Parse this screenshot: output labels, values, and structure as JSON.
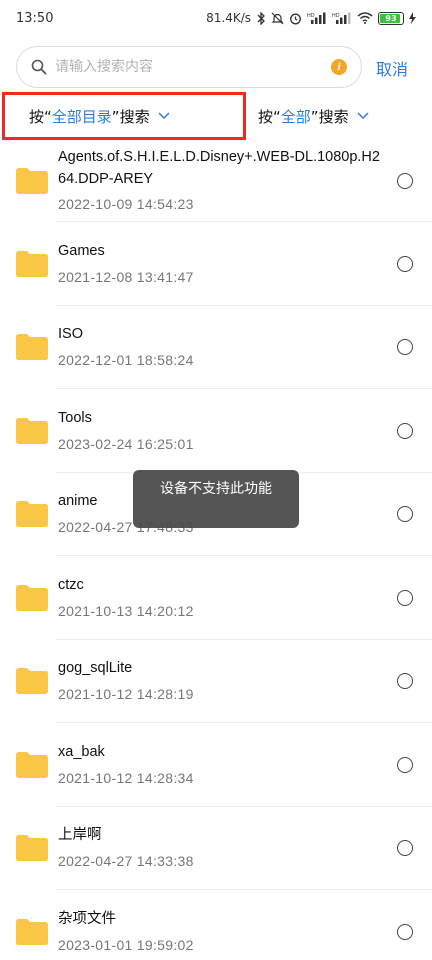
{
  "status_bar": {
    "time": "13:50",
    "network_speed": "81.4K/s",
    "battery_level": "93",
    "accent_battery": "#3cc13c"
  },
  "search": {
    "placeholder": "请输入搜索内容",
    "value": "",
    "cancel_label": "取消"
  },
  "filters": {
    "scope": {
      "prefix": "按“",
      "value": "全部目录",
      "suffix": "”搜索"
    },
    "type": {
      "prefix": "按“",
      "value": "全部",
      "suffix": "”搜索"
    }
  },
  "files": [
    {
      "name": "Agents.of.S.H.I.E.L.D.Disney+.WEB-DL.1080p.H264.DDP-AREY",
      "date": "2022-10-09 14:54:23"
    },
    {
      "name": "Games",
      "date": "2021-12-08 13:41:47"
    },
    {
      "name": "ISO",
      "date": "2022-12-01 18:58:24"
    },
    {
      "name": "Tools",
      "date": "2023-02-24 16:25:01"
    },
    {
      "name": "anime",
      "date": "2022-04-27 17:48:33"
    },
    {
      "name": "ctzc",
      "date": "2021-10-13 14:20:12"
    },
    {
      "name": "gog_sqlLite",
      "date": "2021-10-12 14:28:19"
    },
    {
      "name": "xa_bak",
      "date": "2021-10-12 14:28:34"
    },
    {
      "name": "上岸啊",
      "date": "2022-04-27 14:33:38"
    },
    {
      "name": "杂项文件",
      "date": "2023-01-01 19:59:02"
    }
  ],
  "toast": {
    "message": "设备不支持此功能"
  },
  "colors": {
    "accent": "#2a7de1",
    "highlight_border": "#f02a1d",
    "folder": "#f9c645"
  },
  "icons": {
    "search": "search-icon",
    "info": "info-icon",
    "folder": "folder-icon",
    "radio": "radio-unchecked-icon",
    "chevron": "chevron-down-icon"
  }
}
